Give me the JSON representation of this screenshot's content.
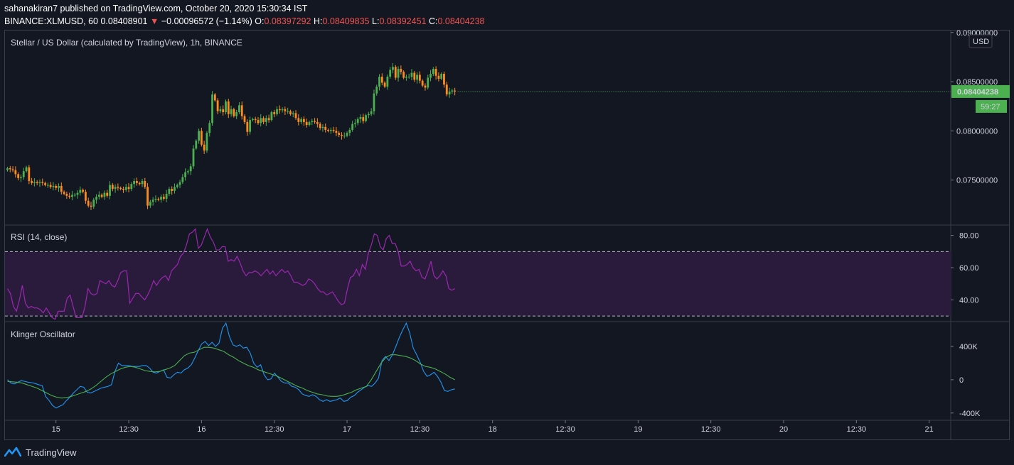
{
  "header": {
    "published": "sahanakiran7 published on TradingView.com, October 20, 2020 15:30:34 IST",
    "symbol": "BINANCE:XLMUSD, 60",
    "last": "0.08408901",
    "arrow": "▼",
    "change": "−0.00096572 (−1.14%)",
    "o_label": "O:",
    "o_value": "0.08397292",
    "h_label": "H:",
    "h_value": "0.08409835",
    "l_label": "L:",
    "l_value": "0.08392451",
    "c_label": "C:",
    "c_value": "0.08404238"
  },
  "footer": {
    "brand": "TradingView"
  },
  "colors": {
    "background": "#131722",
    "up": "#4caf50",
    "down": "#ff8c1a",
    "rsi_line": "#9c27b0",
    "rsi_band": "#2a1b3d",
    "klinger": "#2196f3",
    "signal": "#4caf50",
    "grid": "#363a45"
  },
  "chart_data": [
    {
      "type": "candlestick",
      "title": "Stellar / US Dollar (calculated by TradingView), 1h, BINANCE",
      "currency_label": "USD",
      "price_badge": "0.08404238",
      "countdown": "59:27",
      "ylim": [
        0.0705,
        0.0902
      ],
      "y_ticks": [
        "0.09000000",
        "0.08500000",
        "0.08000000",
        "0.07500000"
      ],
      "y_tick_values": [
        0.09,
        0.085,
        0.08,
        0.075
      ],
      "x_ticks": [
        "15",
        "12:30",
        "16",
        "12:30",
        "17",
        "12:30",
        "18",
        "12:30",
        "19",
        "12:30",
        "20",
        "12:30",
        "21"
      ],
      "x_tick_times": [
        18,
        45,
        72,
        99,
        126,
        153,
        180,
        207,
        234,
        261,
        288,
        315,
        342
      ],
      "closes": [
        0.0762,
        0.0761,
        0.076,
        0.0756,
        0.0752,
        0.0753,
        0.0759,
        0.0763,
        0.0749,
        0.0747,
        0.0748,
        0.0747,
        0.0748,
        0.0747,
        0.0745,
        0.0745,
        0.0743,
        0.0744,
        0.0742,
        0.0744,
        0.0738,
        0.0736,
        0.0734,
        0.0733,
        0.0735,
        0.0735,
        0.0737,
        0.074,
        0.0738,
        0.0729,
        0.0724,
        0.0723,
        0.073,
        0.0733,
        0.0735,
        0.0733,
        0.0737,
        0.0734,
        0.0745,
        0.0741,
        0.0743,
        0.0742,
        0.0741,
        0.074,
        0.0743,
        0.0741,
        0.0746,
        0.0749,
        0.0747,
        0.0746,
        0.0749,
        0.0743,
        0.0724,
        0.0728,
        0.073,
        0.0731,
        0.073,
        0.0733,
        0.0731,
        0.0736,
        0.0741,
        0.0739,
        0.0743,
        0.0745,
        0.0748,
        0.0753,
        0.0758,
        0.0759,
        0.0764,
        0.0782,
        0.079,
        0.08,
        0.0786,
        0.078,
        0.0798,
        0.0808,
        0.0837,
        0.0831,
        0.082,
        0.0822,
        0.0819,
        0.083,
        0.0817,
        0.0822,
        0.0815,
        0.0819,
        0.0826,
        0.0815,
        0.0809,
        0.0799,
        0.0811,
        0.0812,
        0.0811,
        0.0808,
        0.0813,
        0.0809,
        0.0813,
        0.0811,
        0.0819,
        0.0817,
        0.0822,
        0.0821,
        0.0822,
        0.082,
        0.082,
        0.0817,
        0.0818,
        0.0813,
        0.0809,
        0.0812,
        0.0809,
        0.0806,
        0.0809,
        0.081,
        0.0809,
        0.0807,
        0.0803,
        0.0804,
        0.0801,
        0.08,
        0.0801,
        0.08,
        0.0798,
        0.0796,
        0.0795,
        0.0795,
        0.0798,
        0.0801,
        0.0807,
        0.0808,
        0.0812,
        0.0814,
        0.081,
        0.0816,
        0.0817,
        0.082,
        0.0838,
        0.0845,
        0.0855,
        0.0849,
        0.0845,
        0.0855,
        0.0862,
        0.0865,
        0.0854,
        0.0863,
        0.086,
        0.0854,
        0.0855,
        0.0855,
        0.0859,
        0.0852,
        0.0857,
        0.0851,
        0.0846,
        0.0844,
        0.0854,
        0.0858,
        0.0863,
        0.0856,
        0.0853,
        0.0858,
        0.0847,
        0.0837,
        0.084,
        0.0841,
        0.084
      ]
    },
    {
      "type": "line",
      "title": "RSI (14, close)",
      "ylim": [
        27,
        86
      ],
      "y_ticks": [
        "80.00",
        "60.00",
        "40.00"
      ],
      "y_tick_values": [
        80,
        60,
        40
      ],
      "bands": [
        70,
        30
      ],
      "series": [
        {
          "values": [
            47,
            44,
            36,
            33,
            40,
            49,
            38,
            35,
            36,
            35,
            35,
            34,
            32,
            35,
            32,
            29,
            28,
            33,
            33,
            33,
            41,
            43,
            36,
            29,
            29,
            29,
            36,
            47,
            44,
            43,
            44,
            52,
            51,
            50,
            52,
            49,
            48,
            52,
            57,
            58,
            58,
            38,
            41,
            44,
            44,
            42,
            40,
            43,
            47,
            52,
            49,
            52,
            54,
            55,
            52,
            58,
            60,
            62,
            67,
            69,
            74,
            81,
            82,
            84,
            72,
            74,
            79,
            84,
            79,
            76,
            71,
            71,
            73,
            73,
            64,
            65,
            64,
            67,
            63,
            58,
            55,
            57,
            57,
            58,
            57,
            55,
            57,
            59,
            56,
            58,
            55,
            57,
            59,
            57,
            58,
            55,
            51,
            51,
            50,
            49,
            50,
            53,
            52,
            50,
            47,
            45,
            45,
            43,
            44,
            45,
            42,
            39,
            37,
            38,
            47,
            54,
            55,
            59,
            55,
            62,
            59,
            69,
            74,
            81,
            80,
            73,
            71,
            78,
            80,
            75,
            75,
            70,
            61,
            61,
            62,
            64,
            60,
            58,
            59,
            54,
            53,
            58,
            64,
            55,
            53,
            55,
            58,
            55,
            47,
            46,
            47
          ]
        }
      ]
    },
    {
      "type": "line",
      "title": "Klinger Oscillator",
      "ylim": [
        -470,
        690
      ],
      "y_ticks": [
        "400K",
        "0",
        "-400K"
      ],
      "y_tick_values": [
        400,
        0,
        -400
      ],
      "series": [
        {
          "values": [
            0,
            -40,
            -50,
            -30,
            -10,
            -20,
            -30,
            -35,
            -45,
            -60,
            -70,
            -200,
            -250,
            -310,
            -340,
            -320,
            -300,
            -250,
            -210,
            -160,
            -120,
            -80,
            -90,
            -150,
            -160,
            -140,
            -120,
            -100,
            -90,
            -80,
            -60,
            100,
            200,
            170,
            170,
            170,
            160,
            160,
            160,
            170,
            170,
            140,
            90,
            80,
            100,
            120,
            30,
            20,
            60,
            90,
            80,
            120,
            140,
            180,
            260,
            350,
            430,
            460,
            410,
            450,
            400,
            440,
            620,
            680,
            520,
            420,
            400,
            420,
            380,
            390,
            320,
            200,
            150,
            180,
            60,
            0,
            10,
            80,
            30,
            -20,
            -40,
            -40,
            -80,
            -90,
            -120,
            -170,
            -190,
            -200,
            -180,
            -200,
            -240,
            -260,
            -240,
            -260,
            -250,
            -240,
            -220,
            -260,
            -250,
            -210,
            -190,
            -150,
            -120,
            -90,
            -70,
            -80,
            -40,
            20,
            230,
            280,
            230,
            300,
            400,
            510,
            600,
            680,
            560,
            380,
            300,
            210,
            100,
            40,
            60,
            90,
            40,
            -30,
            -130,
            -140,
            -120,
            -110
          ]
        },
        {
          "values": [
            -20,
            -25,
            -30,
            -40,
            -60,
            -80,
            -100,
            -130,
            -160,
            -190,
            -210,
            -220,
            -215,
            -200,
            -180,
            -160,
            -140,
            -110,
            -70,
            -20,
            30,
            70,
            100,
            130,
            150,
            160,
            150,
            130,
            110,
            100,
            95,
            100,
            120,
            140,
            170,
            230,
            290,
            320,
            330,
            360,
            390,
            390,
            380,
            360,
            340,
            300,
            270,
            230,
            200,
            170,
            150,
            120,
            100,
            80,
            60,
            40,
            10,
            -20,
            -50,
            -80,
            -100,
            -130,
            -150,
            -170,
            -180,
            -195,
            -200,
            -200,
            -190,
            -170,
            -150,
            -120,
            -100,
            -80,
            0,
            100,
            200,
            270,
            300,
            300,
            290,
            280,
            260,
            230,
            190,
            160,
            150,
            130,
            100,
            70,
            30,
            0
          ]
        }
      ]
    }
  ]
}
